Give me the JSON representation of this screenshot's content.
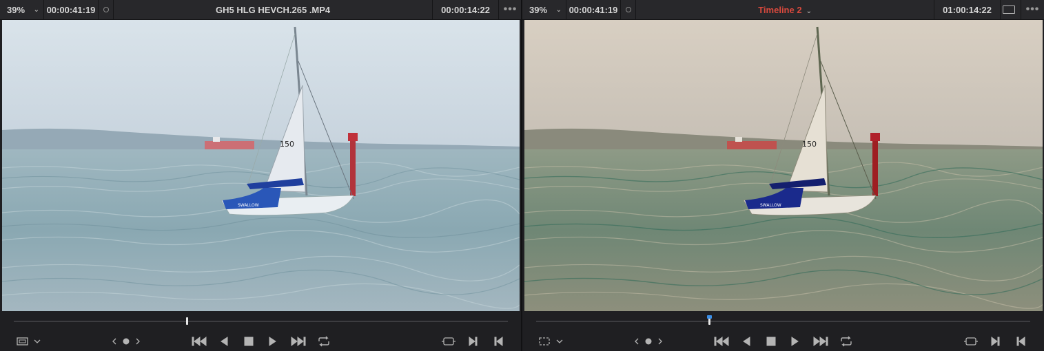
{
  "left_viewer": {
    "zoom": "39%",
    "source_timecode": "00:00:41:19",
    "title": "GH5 HLG HEVCH.265 .MP4",
    "timecode": "00:00:14:22",
    "scrub_position": 0.35
  },
  "right_viewer": {
    "zoom": "39%",
    "source_timecode": "00:00:41:19",
    "title": "Timeline 2",
    "timecode": "01:00:14:22",
    "scrub_position": 0.35
  },
  "icons": {
    "zoom_dropdown": "chevron-down-icon",
    "menu": "more-horizontal-icon",
    "clip_view": "safe-area-icon",
    "jog": "jog-wheel-icon",
    "first_frame": "go-to-first-frame-icon",
    "reverse": "play-reverse-icon",
    "stop": "stop-icon",
    "play": "play-icon",
    "last_frame": "go-to-last-frame-icon",
    "loop": "loop-icon",
    "match_frame": "match-frame-icon",
    "mark_in": "mark-in-icon",
    "mark_out": "mark-out-icon"
  },
  "colors": {
    "timeline_title": "#d8493d",
    "playhead_marker": "#3a8ee6"
  }
}
